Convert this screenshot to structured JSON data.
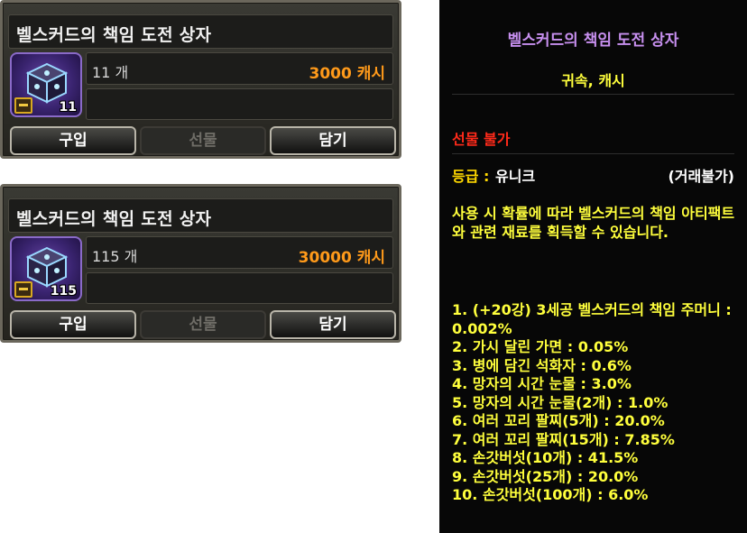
{
  "item_panels": [
    {
      "name": "벨스커드의 책임 도전 상자",
      "count": "11 개",
      "price": "3000 캐시",
      "badge": "11",
      "buttons": {
        "buy": "구입",
        "gift": "선물",
        "cart": "담기"
      }
    },
    {
      "name": "벨스커드의 책임 도전 상자",
      "count": "115 개",
      "price": "30000 캐시",
      "badge": "115",
      "buttons": {
        "buy": "구입",
        "gift": "선물",
        "cart": "담기"
      }
    }
  ],
  "tooltip": {
    "title": "벨스커드의 책임 도전 상자",
    "subtitle": "귀속, 캐시",
    "gift_restriction": "선물 불가",
    "grade_label": "등급 :",
    "grade_value": "유니크",
    "trade_status": "(거래불가)",
    "description": "사용 시 확률에 따라 벨스커드의 책임 아티팩트와 관련 재료를 획득할 수 있습니다.",
    "drops": [
      "1. (+20강) 3세공 벨스커드의 책임 주머니 : 0.002%",
      "2. 가시 달린 가면 : 0.05%",
      "3. 병에 담긴 석화자 : 0.6%",
      "4. 망자의 시간 눈물 : 3.0%",
      "5. 망자의 시간 눈물(2개) : 1.0%",
      "6. 여러 꼬리 팔찌(5개) : 20.0%",
      "7. 여러 꼬리 팔찌(15개) : 7.85%",
      "8. 손갓버섯(10개) : 41.5%",
      "9. 손갓버섯(25개) : 20.0%",
      "10. 손갓버섯(100개) : 6.0%"
    ]
  },
  "colors": {
    "price": "#ff9a1a",
    "tooltip_title": "#c890f0",
    "tooltip_yellow": "#ffff3c",
    "gift_restriction": "#ff2a1a",
    "grade_label": "#ffd800"
  },
  "icons": {
    "item": "cube-box-icon",
    "badge": "treasure-chest-icon"
  }
}
